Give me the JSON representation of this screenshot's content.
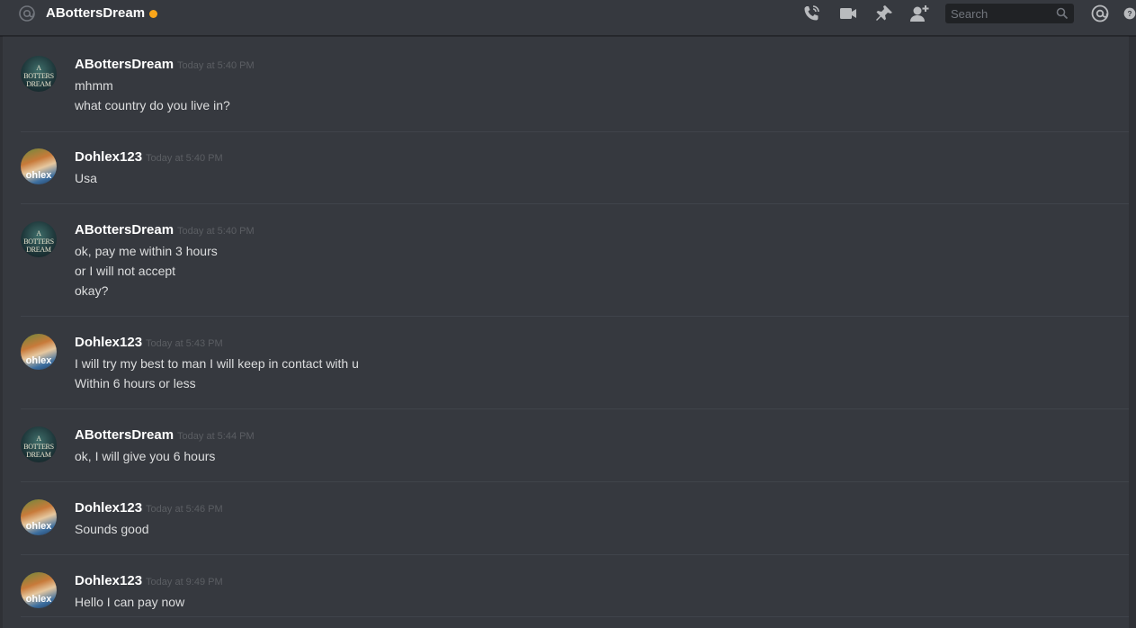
{
  "header": {
    "channel_name": "ABottersDream",
    "status_color": "#faa61a",
    "search_placeholder": "Search",
    "icons": [
      "at-icon",
      "call-icon",
      "video-icon",
      "pin-icon",
      "add-member-icon",
      "search-icon",
      "mention-icon",
      "help-icon"
    ]
  },
  "messages": [
    {
      "author": "ABottersDream",
      "timestamp": "Today at 5:40 PM",
      "avatar": "abd",
      "lines": [
        "mhmm",
        "what country do you live in?"
      ]
    },
    {
      "author": "Dohlex123",
      "timestamp": "Today at 5:40 PM",
      "avatar": "dohlex",
      "lines": [
        "Usa"
      ]
    },
    {
      "author": "ABottersDream",
      "timestamp": "Today at 5:40 PM",
      "avatar": "abd",
      "lines": [
        "ok, pay me within 3 hours",
        "or I will not accept",
        "okay?"
      ]
    },
    {
      "author": "Dohlex123",
      "timestamp": "Today at 5:43 PM",
      "avatar": "dohlex",
      "lines": [
        "I will try my best to man I will keep in contact with u",
        "Within 6 hours or less"
      ]
    },
    {
      "author": "ABottersDream",
      "timestamp": "Today at 5:44 PM",
      "avatar": "abd",
      "lines": [
        "ok, I will give you 6 hours"
      ]
    },
    {
      "author": "Dohlex123",
      "timestamp": "Today at 5:46 PM",
      "avatar": "dohlex",
      "lines": [
        "Sounds good"
      ]
    },
    {
      "author": "Dohlex123",
      "timestamp": "Today at 9:49 PM",
      "avatar": "dohlex",
      "lines": [
        "Hello I can pay now"
      ]
    }
  ],
  "avatar_text": {
    "abd": [
      "A BOTTERS",
      "DREAM"
    ],
    "dohlex": "ohlex"
  }
}
